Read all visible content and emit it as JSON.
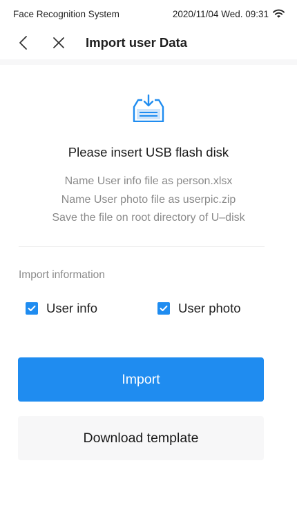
{
  "status_bar": {
    "app_name": "Face Recognition System",
    "datetime": "2020/11/04  Wed.  09:31",
    "wifi_icon": "wifi-icon"
  },
  "nav": {
    "back_icon": "chevron-left-icon",
    "close_icon": "close-icon",
    "title": "Import user Data"
  },
  "main": {
    "usb_icon": "usb-import-icon",
    "heading": "Please insert USB flash disk",
    "hints": [
      "Name User info file as person.xlsx",
      "Name User photo file as userpic.zip",
      "Save the file on root directory of U–disk"
    ]
  },
  "import_info": {
    "label": "Import information",
    "options": [
      {
        "label": "User info",
        "checked": true
      },
      {
        "label": "User photo",
        "checked": true
      }
    ]
  },
  "buttons": {
    "import_label": "Import",
    "template_label": "Download template"
  },
  "colors": {
    "accent": "#1f8cf0",
    "secondary_bg": "#f7f7f8",
    "hint_text": "#8a8a8a"
  }
}
